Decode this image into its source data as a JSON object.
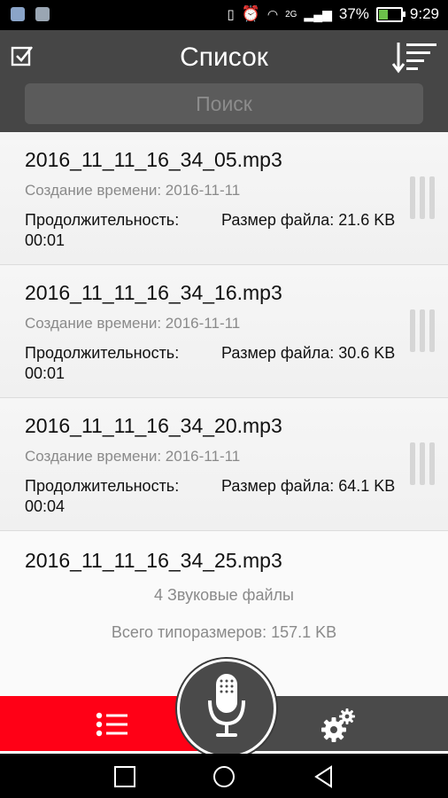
{
  "status": {
    "network": "2G",
    "battery": "37%",
    "battery_level": 0.37,
    "time": "9:29"
  },
  "header": {
    "title": "Список",
    "search_placeholder": "Поиск"
  },
  "files": [
    {
      "name": "2016_11_11_16_34_05.mp3",
      "created": "Создание времени: 2016-11-11",
      "duration_label": "Продолжительность:",
      "duration": "00:01",
      "size": "Размер файла: 21.6 KB"
    },
    {
      "name": "2016_11_11_16_34_16.mp3",
      "created": "Создание времени: 2016-11-11",
      "duration_label": "Продолжительность:",
      "duration": "00:01",
      "size": "Размер файла: 30.6 KB"
    },
    {
      "name": "2016_11_11_16_34_20.mp3",
      "created": "Создание времени: 2016-11-11",
      "duration_label": "Продолжительность:",
      "duration": "00:04",
      "size": "Размер файла: 64.1 KB"
    }
  ],
  "last_file": {
    "name": "2016_11_11_16_34_25.mp3"
  },
  "summary": {
    "count": "4 Звуковые файлы",
    "total": "Всего типоразмеров: 157.1 KB"
  },
  "icons": {
    "select": "checkbox-icon",
    "sort": "sort-icon",
    "list": "list-icon",
    "mic": "microphone-icon",
    "settings": "gear-icon",
    "nav": [
      "square-icon",
      "circle-icon",
      "back-triangle-icon"
    ]
  },
  "colors": {
    "accent": "#ff0016",
    "header": "#464646",
    "bottom": "#4a4a4a"
  }
}
